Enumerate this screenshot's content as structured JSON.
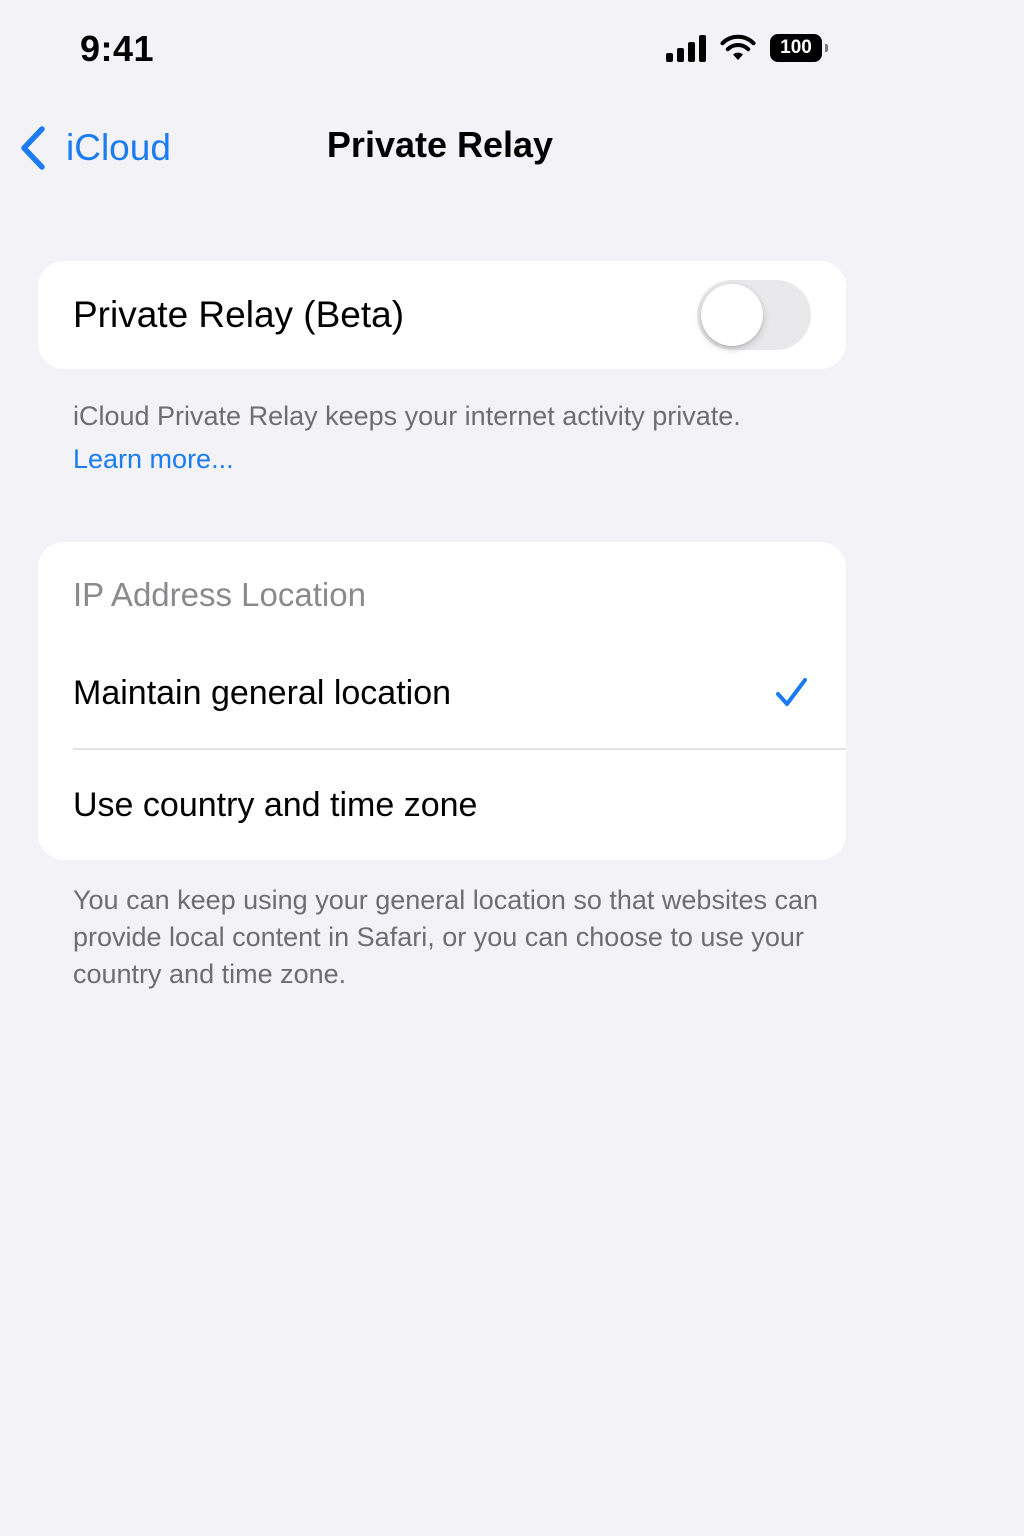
{
  "status_bar": {
    "time": "9:41",
    "battery_percent": "100",
    "icons": [
      "cellular-signal-icon",
      "wifi-icon",
      "battery-icon"
    ]
  },
  "nav": {
    "back_label": "iCloud",
    "title": "Private Relay"
  },
  "private_relay": {
    "label": "Private Relay (Beta)",
    "enabled": false,
    "footer": "iCloud Private Relay keeps your internet activity private.",
    "learn_more": "Learn more..."
  },
  "ip_location": {
    "header": "IP Address Location",
    "options": [
      {
        "label": "Maintain general location",
        "selected": true
      },
      {
        "label": "Use country and time zone",
        "selected": false
      }
    ],
    "footer": "You can keep using your general location so that websites can provide local content in Safari, or you can choose to use your country and time zone."
  },
  "colors": {
    "accent": "#1a7cf0",
    "background": "#f2f2f7",
    "card": "#ffffff",
    "secondary_text": "#6d6d72",
    "toggle_off": "#e9e9eb"
  }
}
